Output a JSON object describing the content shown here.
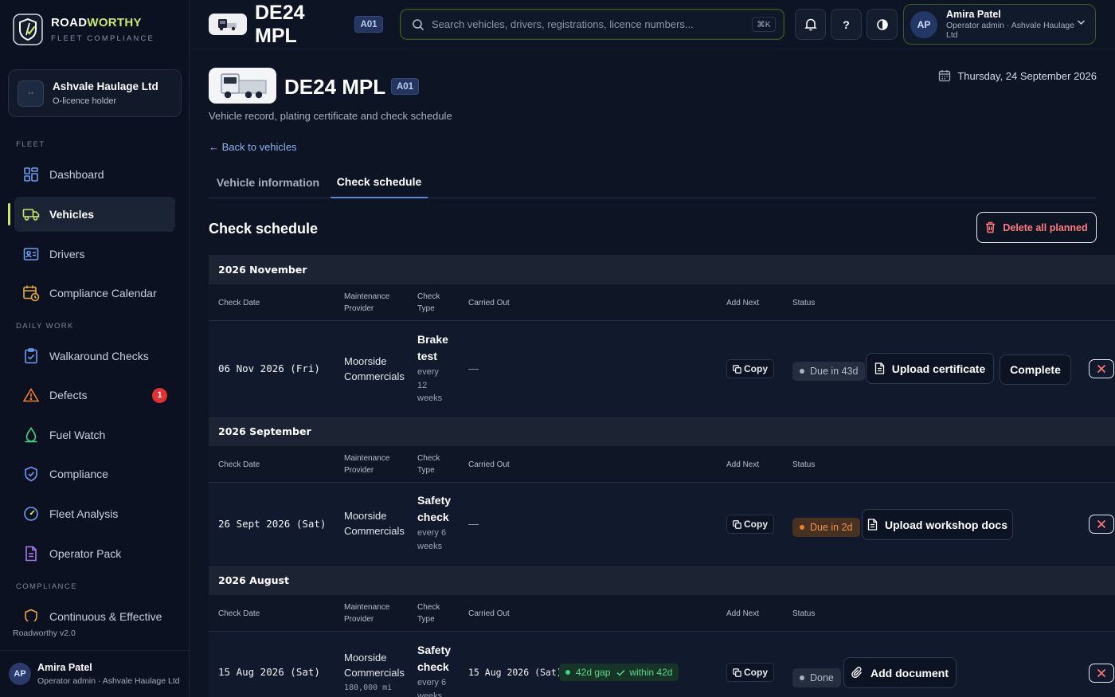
{
  "brand": {
    "name_part1": "ROAD",
    "name_part2": "WORTHY",
    "subtitle": "FLEET COMPLIANCE"
  },
  "org": {
    "initials": "··",
    "name": "Ashvale Haulage Ltd",
    "role": "O-licence holder"
  },
  "nav": {
    "section_fleet": "FLEET",
    "section_daily": "DAILY WORK",
    "section_compliance": "COMPLIANCE",
    "items": [
      {
        "label": "Dashboard"
      },
      {
        "label": "Vehicles"
      },
      {
        "label": "Drivers"
      },
      {
        "label": "Compliance Calendar"
      },
      {
        "label": "Walkaround Checks"
      },
      {
        "label": "Defects",
        "badge": "1"
      },
      {
        "label": "Fuel Watch"
      },
      {
        "label": "Compliance"
      },
      {
        "label": "Fleet Analysis"
      },
      {
        "label": "Operator Pack"
      },
      {
        "label": "Continuous & Effective"
      }
    ]
  },
  "version": "Roadworthy v2.0",
  "user": {
    "initials": "AP",
    "name": "Amira Patel",
    "role": "Operator admin · Ashvale Haulage Ltd"
  },
  "header": {
    "title": "DE24 MPL",
    "tag": "A01",
    "search_placeholder": "Search vehicles, drivers, registrations, licence numbers...",
    "search_shortcut": "⌘K",
    "help_label": "?"
  },
  "vehicle": {
    "title": "DE24 MPL",
    "tag": "A01",
    "subtitle": "Vehicle record, plating certificate and check schedule",
    "back_link": "← Back to vehicles",
    "date": "Thursday, 24 September 2026"
  },
  "tabs": [
    {
      "label": "Vehicle information",
      "active": false
    },
    {
      "label": "Check schedule",
      "active": true
    }
  ],
  "schedule": {
    "title": "Check schedule",
    "delete_label": "Delete all planned",
    "columns": {
      "check_date": "Check Date",
      "provider_1": "Maintenance",
      "provider_2": "Provider",
      "type_1": "Check",
      "type_2": "Type",
      "carried_out": "Carried Out",
      "add_next": "Add Next",
      "status": "Status"
    },
    "copy_label": "Copy",
    "groups": [
      {
        "month": "2026 November",
        "date": "06 Nov 2026 (Fri)",
        "provider_1": "Moorside",
        "provider_2": "Commercials",
        "type_1": "Brake",
        "type_2": "test",
        "freq_1": "every",
        "freq_2": "12",
        "freq_3": "weeks",
        "carried_out": "—",
        "status": "Due in 43d",
        "action": "Upload certificate",
        "complete": "Complete"
      },
      {
        "month": "2026 September",
        "date": "26 Sept 2026 (Sat)",
        "provider_1": "Moorside",
        "provider_2": "Commercials",
        "type_1": "Safety",
        "type_2": "check",
        "freq_1": "every 6",
        "freq_2": "weeks",
        "carried_out": "—",
        "status": "Due in 2d",
        "action": "Upload workshop docs"
      },
      {
        "month": "2026 August",
        "date": "15 Aug 2026 (Sat)",
        "provider_1": "Moorside",
        "provider_2": "Commercials",
        "mileage": "180,000 mi",
        "type_1": "Safety",
        "type_2": "check",
        "freq_1": "every 6",
        "freq_2": "weeks",
        "carried_out": "15 Aug 2026 (Sat)",
        "gap_label": "42d gap",
        "within_label": "within 42d",
        "status": "Done",
        "action": "Add document"
      }
    ]
  },
  "colors": {
    "accent": "#c8e86a",
    "background": "#0d1424",
    "danger": "#ff7b7b",
    "success": "#58d68d",
    "warning": "#f0924a"
  }
}
